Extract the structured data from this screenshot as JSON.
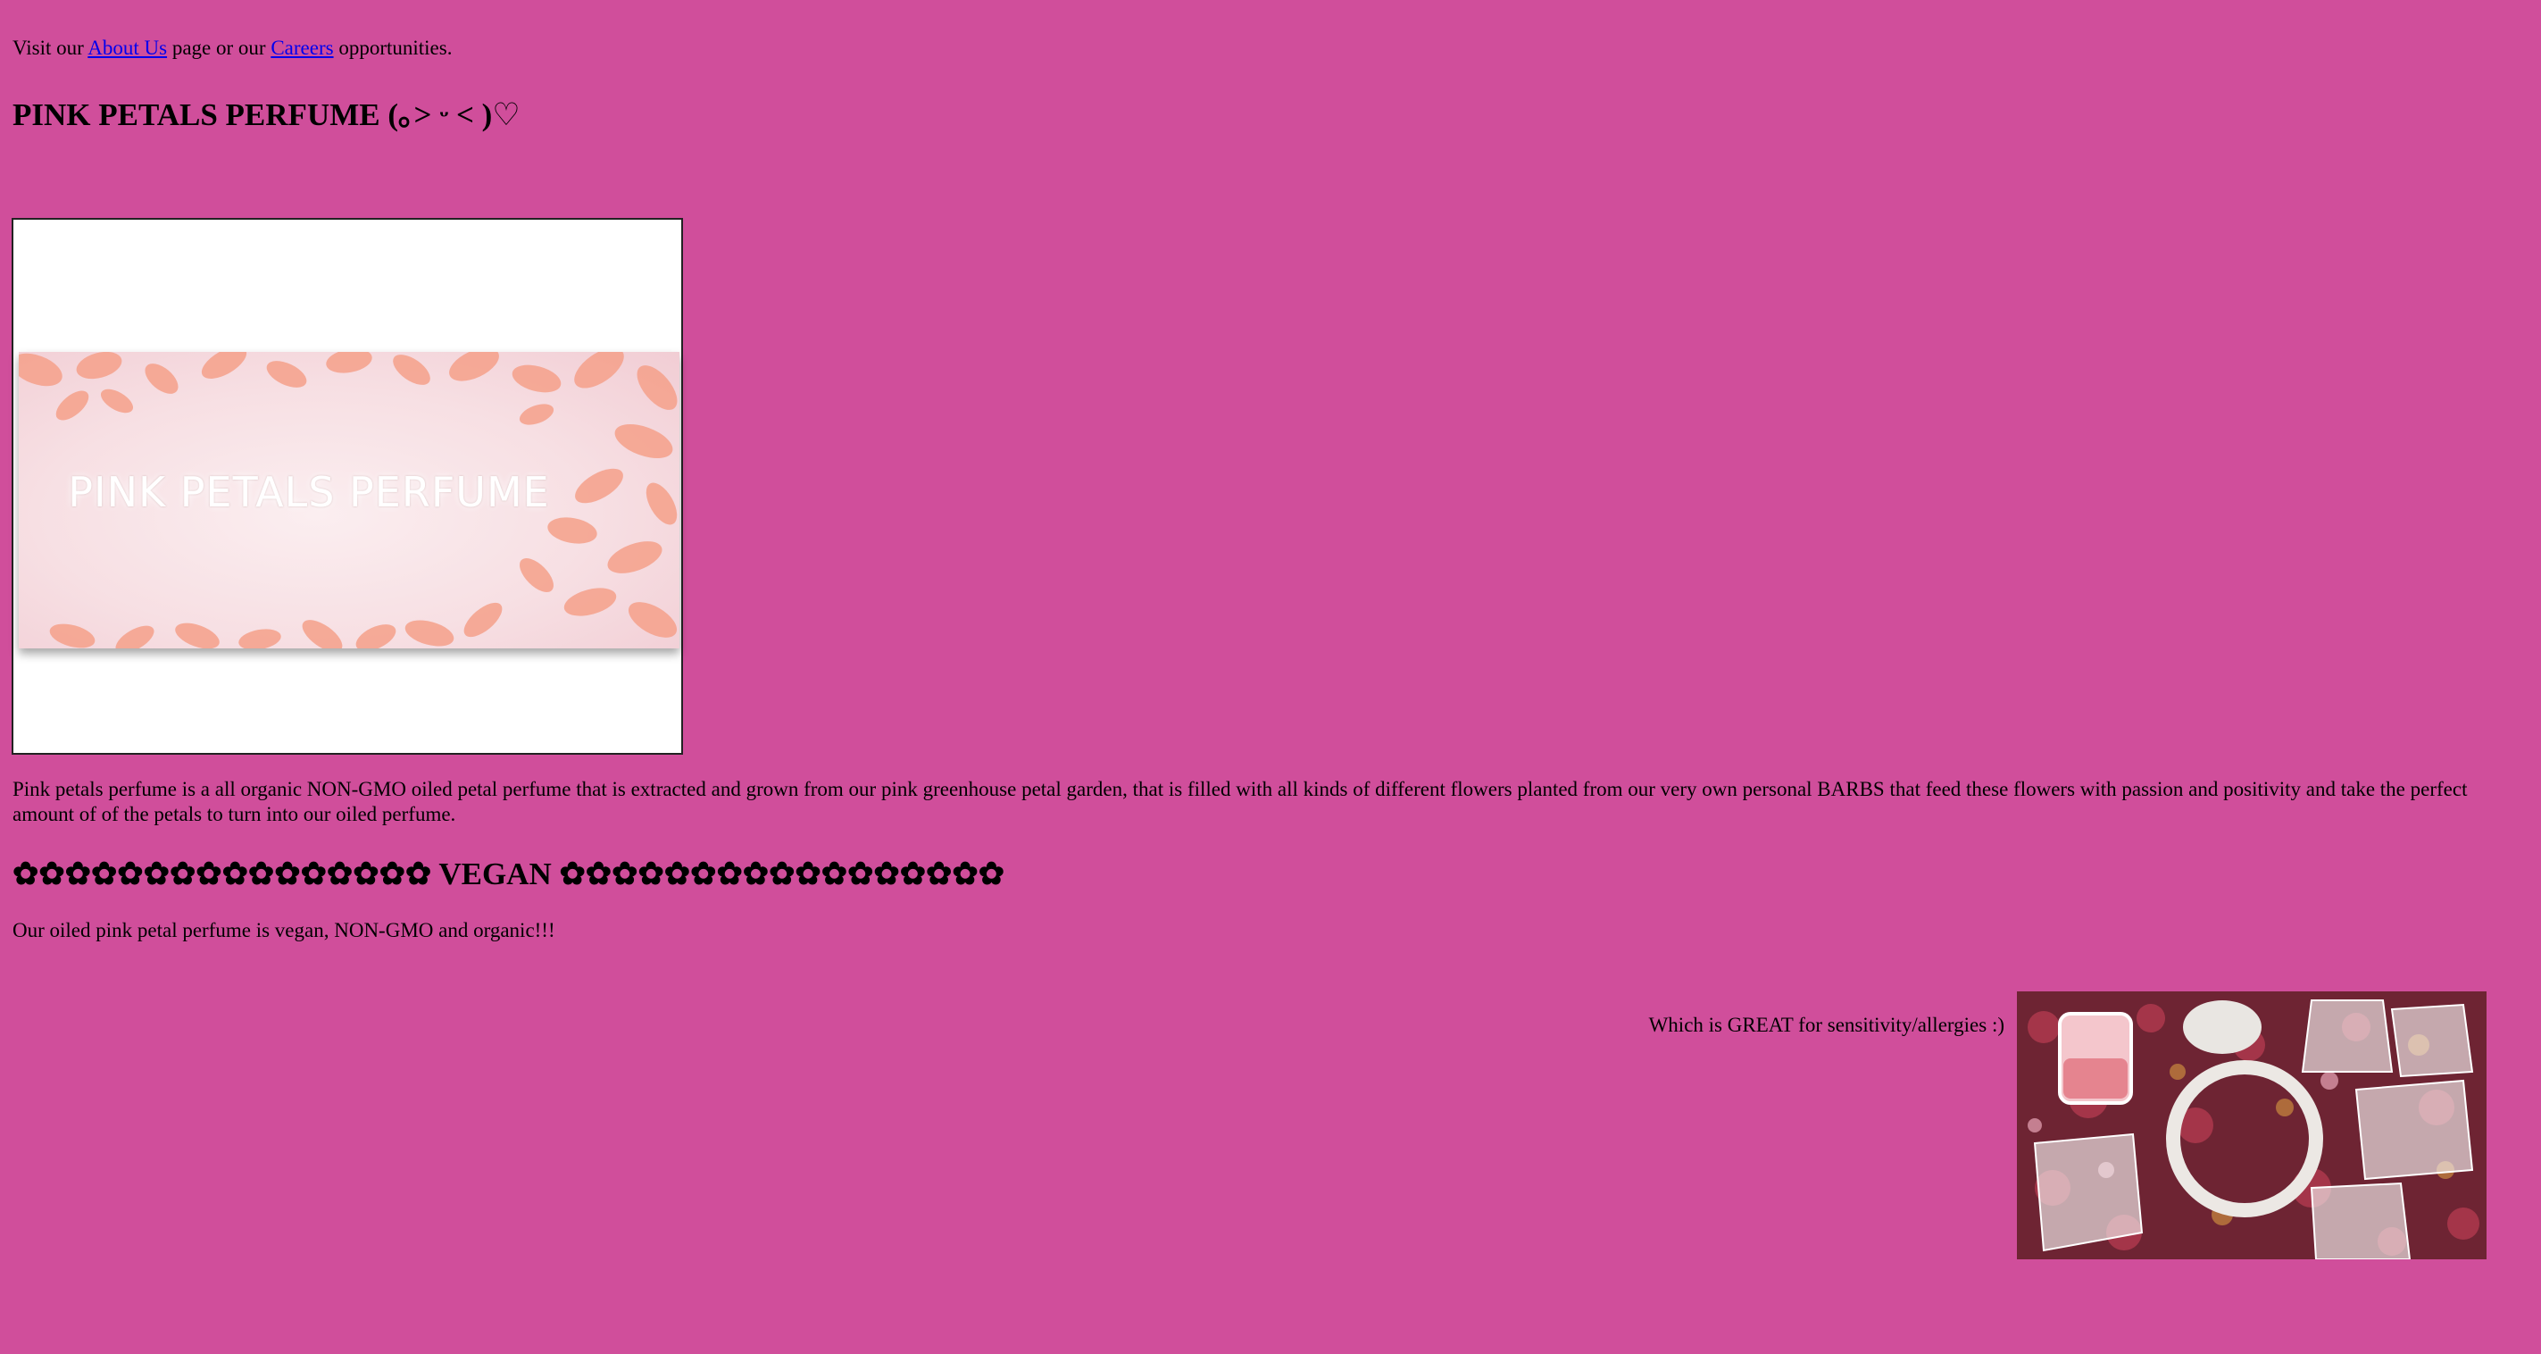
{
  "nav_line": {
    "prefix": "Visit our",
    "about_link": "About Us",
    "middle": "page or our",
    "careers_link": "Careers",
    "suffix": "opportunities."
  },
  "page_title": "PINK PETALS PERFUME (｡˃ ᵕ ˂ )♡",
  "hero_image": {
    "banner_text": "PINK PETALS PERFUME"
  },
  "description": "Pink petals perfume is a all organic NON-GMO oiled petal perfume that is extracted and grown from our pink greenhouse petal garden, that is filled with all kinds of different flowers planted from our very own personal BARBS that feed these flowers with passion and positivity and take the perfect amount of of the petals to turn into our oiled perfume.",
  "vegan_section": {
    "heading": "✿✿✿✿✿✿✿✿✿✿✿✿✿✿✿✿ VEGAN ✿✿✿✿✿✿✿✿✿✿✿✿✿✿✿✿✿",
    "text": "Our oiled pink petal perfume is vegan, NON-GMO and organic!!!"
  },
  "allergy_line": "Which is GREAT for sensitivity/allergies :)",
  "colors": {
    "page_background": "#d04e9b",
    "link": "#0000ee",
    "petal": "#f4a08a"
  }
}
